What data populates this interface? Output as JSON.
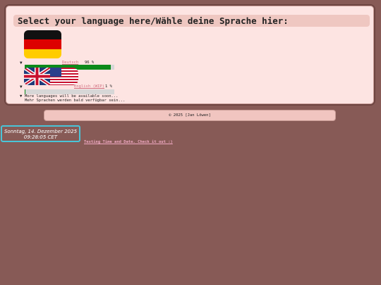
{
  "panel": {
    "title": "Select your language here/Wähle deine Sprache hier:",
    "languages": [
      {
        "name": "Deutsch",
        "percent_text": "96 %",
        "progress": 0.96
      },
      {
        "name": "English (WIP)",
        "percent_text": "1 %",
        "progress": 0.01
      }
    ],
    "more": {
      "line1": "More languages will be available soon...",
      "line2": "Mehr Sprachen werden bald verfügbar sein..."
    }
  },
  "footer": {
    "text": "© 2025 [Jan Löwen]"
  },
  "clock": {
    "date": "Sonntag, 14. Dezember 2025",
    "time": "09:28:05 CET"
  },
  "test_link": {
    "label": "Testing Time and Date. Check it out :)"
  },
  "colors": {
    "background": "#875a56",
    "panel": "#fde4e2",
    "progress": "#0c8a1a",
    "link": "#d06f80",
    "clock_border": "#49c5d8"
  },
  "icons": {
    "de": "germany-flag-icon",
    "en": "uk-us-flag-icon"
  }
}
